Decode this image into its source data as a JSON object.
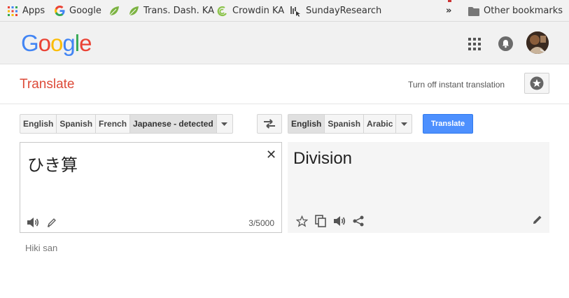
{
  "bookmarks": {
    "apps": "Apps",
    "google": "Google",
    "trans_dash": "Trans. Dash. KA",
    "crowdin": "Crowdin KA",
    "sunday": "SundayResearch",
    "more": "»",
    "other": "Other bookmarks"
  },
  "header": {
    "logo_letters": [
      "G",
      "o",
      "o",
      "g",
      "l",
      "e"
    ],
    "logo_colors": [
      "#4285f4",
      "#ea4335",
      "#fbbc05",
      "#4285f4",
      "#34a853",
      "#ea4335"
    ]
  },
  "title": "Translate",
  "instant_link": "Turn off instant translation",
  "source_langs": [
    "English",
    "Spanish",
    "French",
    "Japanese - detected"
  ],
  "target_langs": [
    "English",
    "Spanish",
    "Arabic"
  ],
  "translate_label": "Translate",
  "source_text": "ひき算",
  "char_count": "3/5000",
  "translated_text": "Division",
  "transliteration": "Hiki san",
  "colors": {
    "accent": "#dd4b39",
    "button_blue": "#4d90fe"
  }
}
